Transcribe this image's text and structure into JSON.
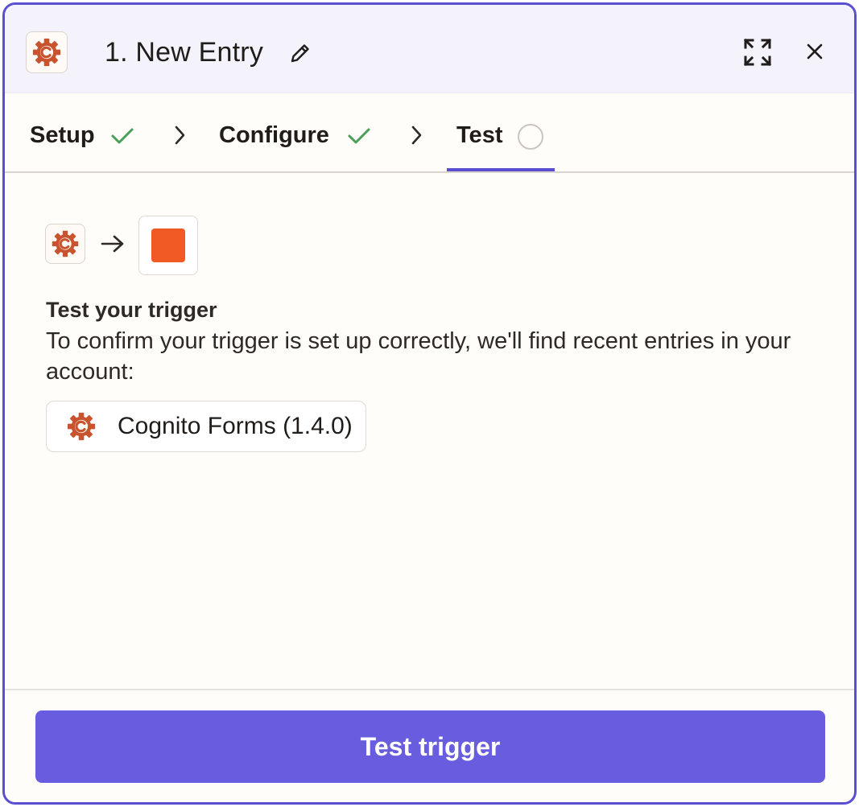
{
  "header": {
    "title": "1. New Entry",
    "app_icon": "cognito-forms-logo",
    "edit_icon": "pencil-icon",
    "expand_icon": "expand-icon",
    "close_icon": "close-icon"
  },
  "steps": [
    {
      "label": "Setup",
      "status": "complete"
    },
    {
      "label": "Configure",
      "status": "complete"
    },
    {
      "label": "Test",
      "status": "pending",
      "active": true
    }
  ],
  "flow": {
    "source_icon": "cognito-forms-logo",
    "arrow_icon": "arrow-right-icon",
    "target_icon": "orange-square-app-icon"
  },
  "content": {
    "heading": "Test your trigger",
    "description": "To confirm your trigger is set up correctly, we'll find recent entries in your account:"
  },
  "account": {
    "label": "Cognito Forms (1.4.0)",
    "icon": "cognito-forms-logo"
  },
  "footer": {
    "button_label": "Test trigger"
  },
  "colors": {
    "accent": "#5b4fd1",
    "button": "#695ddf",
    "check": "#4a9e57",
    "brand_orange": "#f15a24",
    "cognito_logo": "#c8532e"
  }
}
